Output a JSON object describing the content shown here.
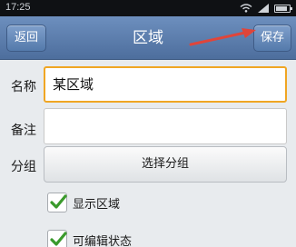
{
  "status_bar": {
    "time": "17:25"
  },
  "nav": {
    "back_label": "返回",
    "title": "区域",
    "save_label": "保存"
  },
  "form": {
    "name_label": "名称",
    "name_value": "某区域",
    "note_label": "备注",
    "note_value": "",
    "group_label": "分组",
    "group_button": "选择分组",
    "checkboxes": [
      {
        "label": "显示区域",
        "checked": true
      },
      {
        "label": "可编辑状态",
        "checked": true
      }
    ]
  },
  "colors": {
    "nav_bar": "#5b7eae",
    "focus_border": "#f0a623",
    "check_green": "#3a9a2c",
    "annotation_arrow": "#e0453a"
  }
}
